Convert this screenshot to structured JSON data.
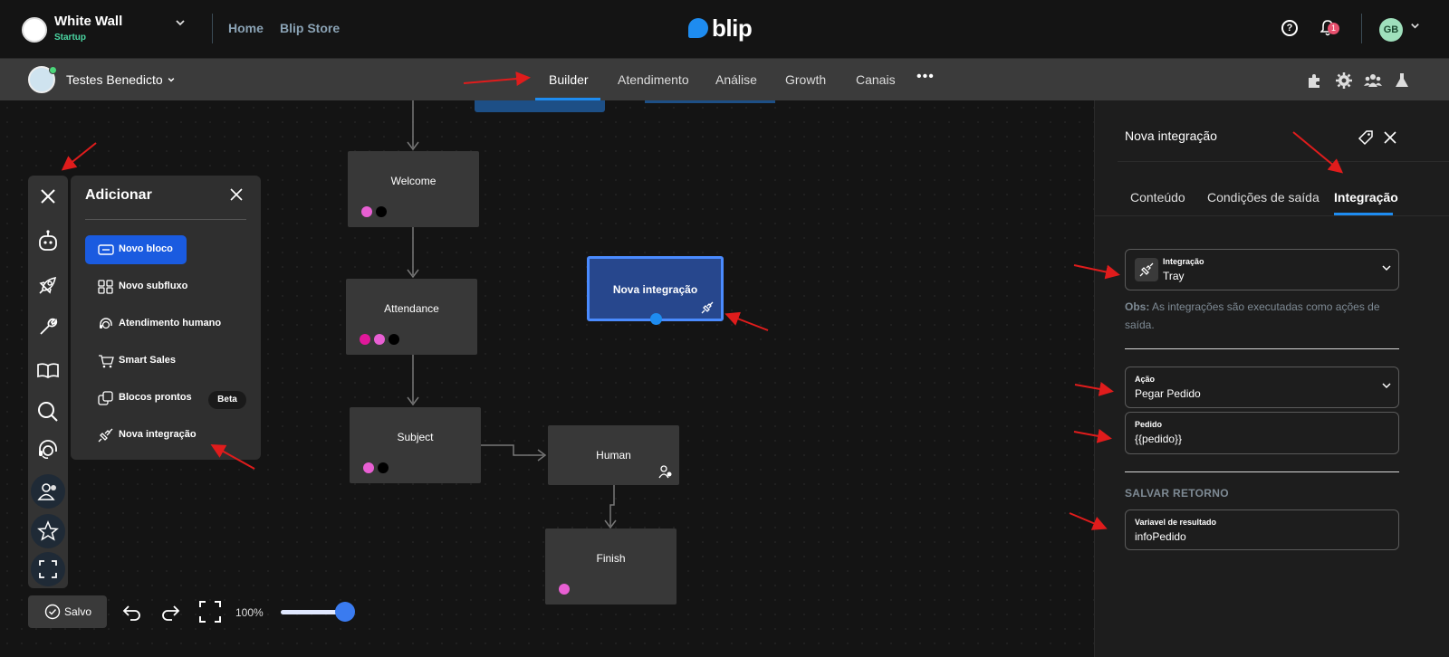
{
  "topbar": {
    "org_name": "White Wall",
    "org_plan": "Startup",
    "links": [
      "Home",
      "Blip Store"
    ],
    "brand": "blip",
    "notifications_count": "1",
    "user_initials": "GB",
    "icons": [
      "help-icon",
      "bell-icon",
      "chevron-down-icon"
    ]
  },
  "navbar": {
    "bot_name": "Testes Benedicto",
    "tabs": [
      "Builder",
      "Atendimento",
      "Análise",
      "Growth",
      "Canais"
    ],
    "active_tab": "Builder",
    "more": "•••",
    "icons": [
      "extensions-icon",
      "settings-icon",
      "team-icon",
      "lab-icon"
    ]
  },
  "canvas": {
    "nodes": [
      {
        "title": "Welcome"
      },
      {
        "title": "Attendance"
      },
      {
        "title": "Subject"
      },
      {
        "title": "Human"
      },
      {
        "title": "Finish"
      },
      {
        "title": "Nova integração"
      }
    ],
    "colors": {
      "pink": "#e85fd3",
      "magenta": "#e0189a",
      "black": "#000000",
      "selected_fill": "#27478d",
      "selected_border": "#4a8bff"
    }
  },
  "add_menu": {
    "title": "Adicionar",
    "items": [
      {
        "label": "Novo bloco",
        "icon": "block-icon"
      },
      {
        "label": "Novo subfluxo",
        "icon": "subflow-icon"
      },
      {
        "label": "Atendimento humano",
        "icon": "headset-icon"
      },
      {
        "label": "Smart Sales",
        "icon": "cart-icon"
      },
      {
        "label": "Blocos prontos",
        "icon": "ready-blocks-icon",
        "badge": "Beta"
      },
      {
        "label": "Nova integração",
        "icon": "plug-icon"
      }
    ]
  },
  "rail": {
    "icons": [
      "close-icon",
      "bot-icon",
      "rocket-icon",
      "wrench-icon",
      "book-icon",
      "search-icon",
      "headset-icon",
      "contacts-icon",
      "star-icon",
      "fullscreen-icon"
    ]
  },
  "bottom_bar": {
    "save_label": "Salvo",
    "zoom": "100%",
    "zoom_level": 1.0
  },
  "panel": {
    "title": "Nova integração",
    "tabs": [
      "Conteúdo",
      "Condições de saída",
      "Integração"
    ],
    "active_tab": "Integração",
    "integration": {
      "label": "Integração",
      "value": "Tray"
    },
    "obs_prefix": "Obs:",
    "obs_text": " As integrações são executadas como ações de saída.",
    "action": {
      "label": "Ação",
      "value": "Pegar Pedido"
    },
    "pedido": {
      "label": "Pedido",
      "value": "{{pedido}}"
    },
    "save_section": "SALVAR RETORNO",
    "result_var": {
      "label": "Variavel de resultado",
      "value": "infoPedido"
    }
  }
}
